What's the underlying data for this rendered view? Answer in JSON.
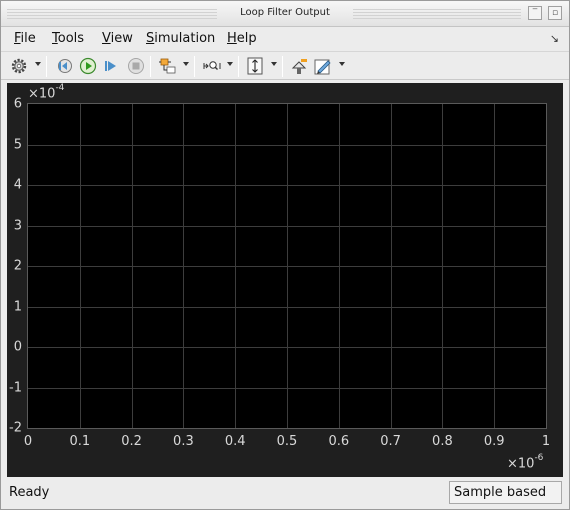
{
  "window": {
    "title": "Loop Filter Output"
  },
  "menu": {
    "items": [
      {
        "underline": "F",
        "rest": "ile"
      },
      {
        "underline": "T",
        "rest": "ools"
      },
      {
        "underline": "V",
        "rest": "iew"
      },
      {
        "underline": "S",
        "rest": "imulation"
      },
      {
        "underline": "H",
        "rest": "elp"
      }
    ],
    "dock_symbol": "↘"
  },
  "toolbar": {
    "icons": [
      "gear-icon",
      "step-back-icon",
      "run-icon",
      "step-forward-icon",
      "stop-icon",
      "signal-select-icon",
      "zoom-axes-icon",
      "autoscale-icon",
      "highlight-block-icon",
      "style-edit-icon"
    ]
  },
  "plot": {
    "y_exponent_base": "×10",
    "y_exponent_power": "-4",
    "x_exponent_base": "×10",
    "x_exponent_power": "-6",
    "y_ticks": [
      "6",
      "5",
      "4",
      "3",
      "2",
      "1",
      "0",
      "-1",
      "-2"
    ],
    "x_ticks": [
      "0",
      "0.1",
      "0.2",
      "0.3",
      "0.4",
      "0.5",
      "0.6",
      "0.7",
      "0.8",
      "0.9",
      "1"
    ],
    "background": "#000000",
    "grid_color": "#3d3d3d",
    "grid": true
  },
  "chart_data": {
    "type": "line",
    "title": "",
    "xlabel": "",
    "ylabel": "",
    "xlim": [
      0,
      1e-06
    ],
    "ylim": [
      -0.0002,
      0.0006
    ],
    "series": []
  },
  "status": {
    "text": "Ready",
    "mode": "Sample based"
  }
}
